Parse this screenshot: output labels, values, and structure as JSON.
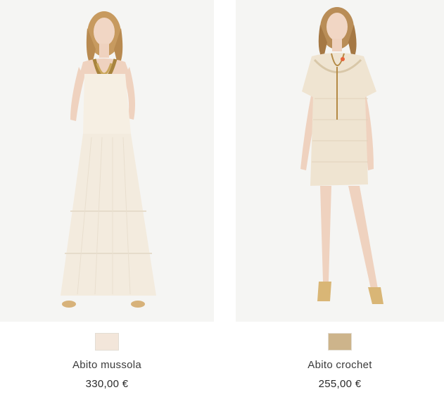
{
  "products": [
    {
      "name": "Abito mussola",
      "price": "330,00 €",
      "swatch_color": "#f3e6da",
      "image_icon": "model-maxi-dress-image"
    },
    {
      "name": "Abito crochet",
      "price": "255,00 €",
      "swatch_color": "#cdb48b",
      "image_icon": "model-crochet-dress-image"
    }
  ],
  "colors": {
    "image_background": "#f5f5f3",
    "text": "#333333"
  }
}
